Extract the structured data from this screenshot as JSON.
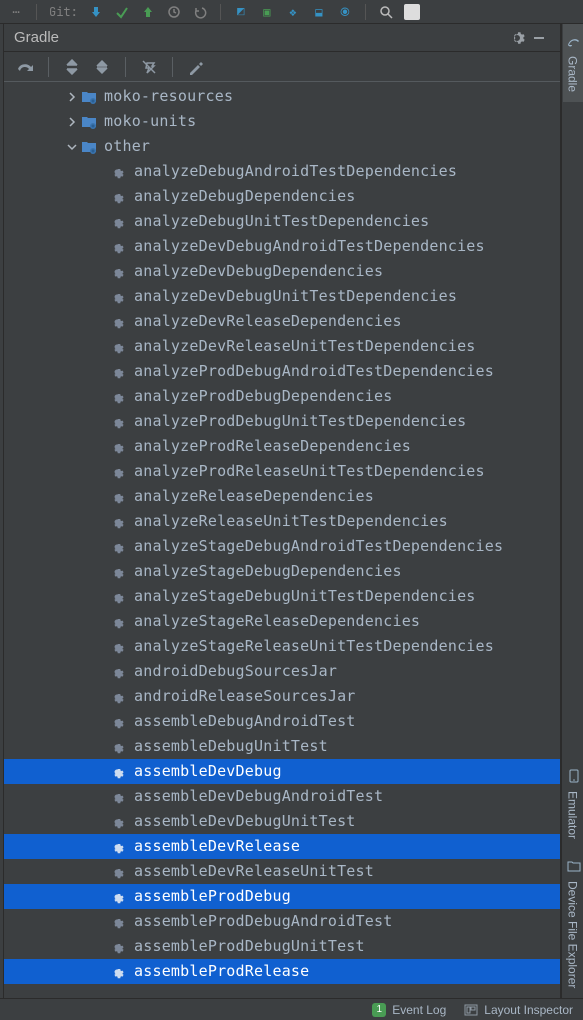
{
  "topbar": {
    "git_label": "Git:"
  },
  "panel": {
    "title": "Gradle"
  },
  "right_tabs": {
    "gradle": "Gradle",
    "emulator": "Emulator",
    "device_file_explorer": "Device File Explorer"
  },
  "statusbar": {
    "event_log_badge": "1",
    "event_log": "Event Log",
    "layout_inspector": "Layout Inspector"
  },
  "tree": {
    "folders": [
      {
        "label": "moko-resources",
        "expanded": false,
        "indent": 60
      },
      {
        "label": "moko-units",
        "expanded": false,
        "indent": 60
      },
      {
        "label": "other",
        "expanded": true,
        "indent": 60
      }
    ],
    "tasks": [
      {
        "label": "analyzeDebugAndroidTestDependencies",
        "selected": false
      },
      {
        "label": "analyzeDebugDependencies",
        "selected": false
      },
      {
        "label": "analyzeDebugUnitTestDependencies",
        "selected": false
      },
      {
        "label": "analyzeDevDebugAndroidTestDependencies",
        "selected": false
      },
      {
        "label": "analyzeDevDebugDependencies",
        "selected": false
      },
      {
        "label": "analyzeDevDebugUnitTestDependencies",
        "selected": false
      },
      {
        "label": "analyzeDevReleaseDependencies",
        "selected": false
      },
      {
        "label": "analyzeDevReleaseUnitTestDependencies",
        "selected": false
      },
      {
        "label": "analyzeProdDebugAndroidTestDependencies",
        "selected": false
      },
      {
        "label": "analyzeProdDebugDependencies",
        "selected": false
      },
      {
        "label": "analyzeProdDebugUnitTestDependencies",
        "selected": false
      },
      {
        "label": "analyzeProdReleaseDependencies",
        "selected": false
      },
      {
        "label": "analyzeProdReleaseUnitTestDependencies",
        "selected": false
      },
      {
        "label": "analyzeReleaseDependencies",
        "selected": false
      },
      {
        "label": "analyzeReleaseUnitTestDependencies",
        "selected": false
      },
      {
        "label": "analyzeStageDebugAndroidTestDependencies",
        "selected": false
      },
      {
        "label": "analyzeStageDebugDependencies",
        "selected": false
      },
      {
        "label": "analyzeStageDebugUnitTestDependencies",
        "selected": false
      },
      {
        "label": "analyzeStageReleaseDependencies",
        "selected": false
      },
      {
        "label": "analyzeStageReleaseUnitTestDependencies",
        "selected": false
      },
      {
        "label": "androidDebugSourcesJar",
        "selected": false
      },
      {
        "label": "androidReleaseSourcesJar",
        "selected": false
      },
      {
        "label": "assembleDebugAndroidTest",
        "selected": false
      },
      {
        "label": "assembleDebugUnitTest",
        "selected": false
      },
      {
        "label": "assembleDevDebug",
        "selected": true
      },
      {
        "label": "assembleDevDebugAndroidTest",
        "selected": false
      },
      {
        "label": "assembleDevDebugUnitTest",
        "selected": false
      },
      {
        "label": "assembleDevRelease",
        "selected": true
      },
      {
        "label": "assembleDevReleaseUnitTest",
        "selected": false
      },
      {
        "label": "assembleProdDebug",
        "selected": true
      },
      {
        "label": "assembleProdDebugAndroidTest",
        "selected": false
      },
      {
        "label": "assembleProdDebugUnitTest",
        "selected": false
      },
      {
        "label": "assembleProdRelease",
        "selected": true
      }
    ],
    "task_indent": 104
  }
}
